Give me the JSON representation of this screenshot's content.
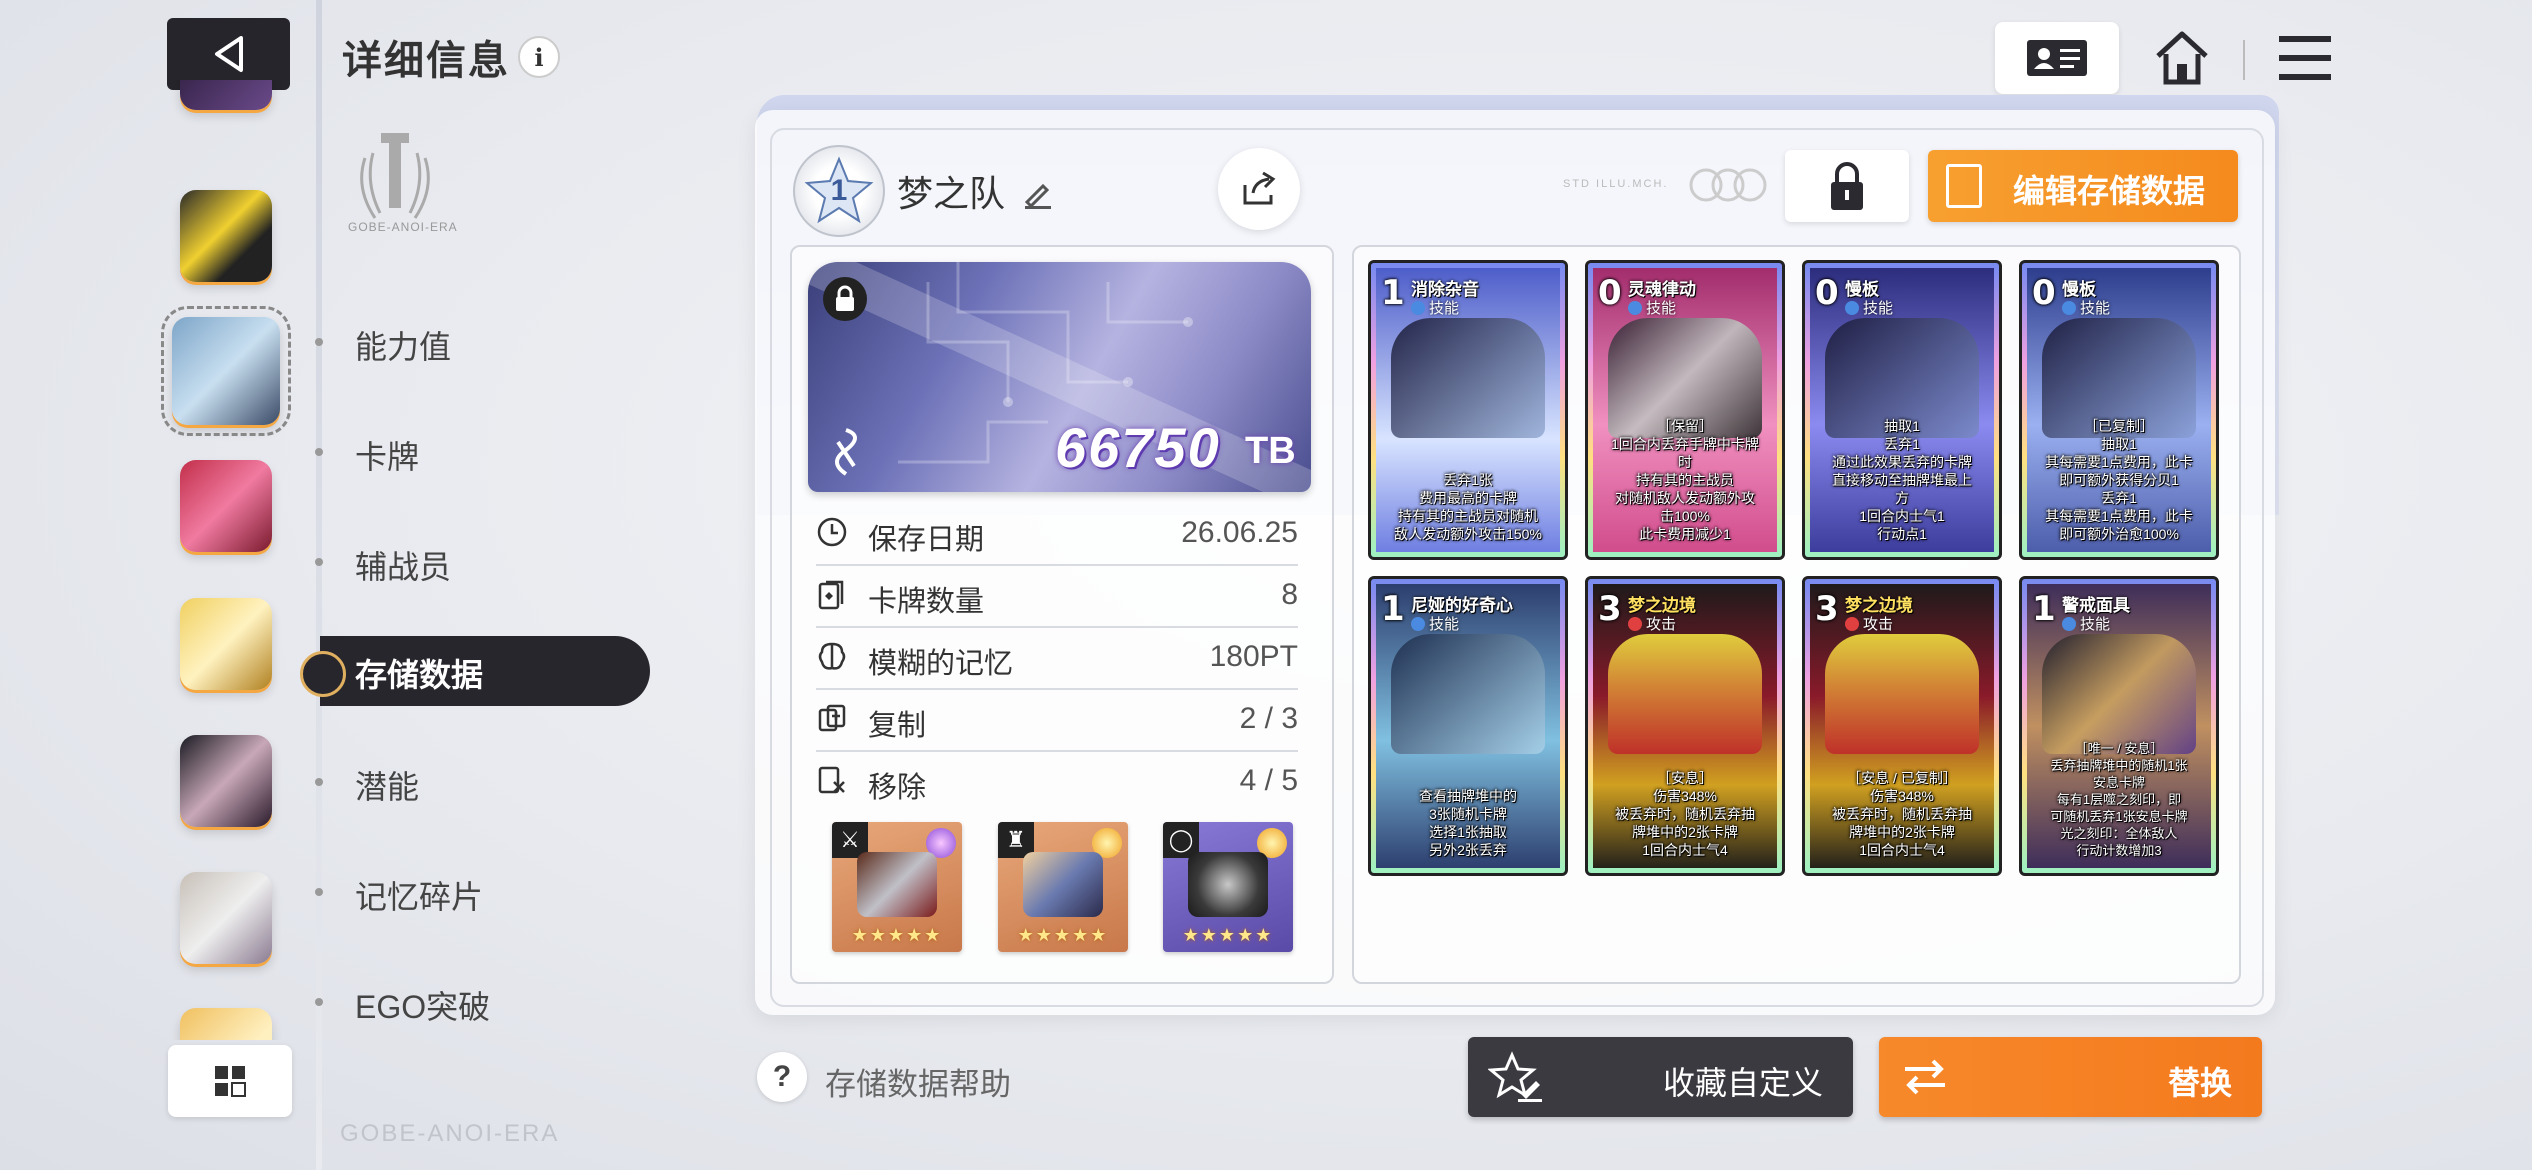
{
  "header": {
    "title": "详细信息",
    "info_icon": "i"
  },
  "nav": {
    "items": [
      "能力值",
      "卡牌",
      "辅战员",
      "存储数据",
      "潜能",
      "记忆碎片",
      "EGO突破"
    ],
    "active_index": 3,
    "active_label": "存储数据"
  },
  "branding": {
    "emblem_text": "GOBE-ANOI-ERA",
    "bottom_logo": "GOBE-ANOI-ERA"
  },
  "deck": {
    "rank": "1",
    "name": "梦之队",
    "lock_tag": "STD ILLU.MCH.",
    "edit_label": "编辑存储数据"
  },
  "tb": {
    "value": "66750",
    "unit": "TB"
  },
  "stats": [
    {
      "label": "保存日期",
      "value": "26.06.25",
      "icon": "clock-icon"
    },
    {
      "label": "卡牌数量",
      "value": "8",
      "icon": "cards-icon"
    },
    {
      "label": "模糊的记忆",
      "value": "180PT",
      "icon": "brain-icon"
    },
    {
      "label": "复制",
      "value": "2 / 3",
      "icon": "copy-icon"
    },
    {
      "label": "移除",
      "value": "4 / 5",
      "icon": "remove-icon"
    }
  ],
  "equipment": [
    {
      "name": "sword-equipment",
      "tag": "⚔",
      "stars": "★★★★★"
    },
    {
      "name": "armor-equipment",
      "tag": "♜",
      "stars": "★★★★★"
    },
    {
      "name": "ring-equipment",
      "tag": "◯",
      "stars": "★★★★★"
    }
  ],
  "cards": [
    {
      "cost": "1",
      "name": "消除杂音",
      "type": "技能",
      "desc": "丢弃1张\n费用最高的卡牌\n持有其的主战员对随机\n敌人发动额外攻击150%",
      "colors": [
        "#5a6ad0",
        "#d0e0ff"
      ]
    },
    {
      "cost": "0",
      "name": "灵魂律动",
      "type": "技能",
      "desc": "［保留］\n1回合内丢弃手牌中卡牌\n时\n持有其的主战员\n对随机敌人发动额外攻\n击100%\n此卡费用减少1",
      "colors": [
        "#c02a6a",
        "#f090c0"
      ]
    },
    {
      "cost": "0",
      "name": "慢板",
      "type": "技能",
      "desc": "抽取1\n丢弃1\n通过此效果丢弃的卡牌\n直接移动至抽牌堆最上\n方\n1回合内士气1\n行动点1",
      "colors": [
        "#3a3a8a",
        "#a0a0ff"
      ]
    },
    {
      "cost": "0",
      "name": "慢板",
      "type": "技能",
      "desc": "［已复制］\n抽取1\n其每需要1点费用，此卡\n即可额外获得分贝1\n丢弃1\n其每需要1点费用，此卡\n即可额外治愈100%",
      "colors": [
        "#3a4a8a",
        "#a0b0ff"
      ]
    },
    {
      "cost": "1",
      "name": "尼娅的好奇心",
      "type": "技能",
      "desc": "查看抽牌堆中的\n3张随机卡牌\n选择1张抽取\n另外2张丢弃",
      "colors": [
        "#2a3a6a",
        "#80c0e0"
      ]
    },
    {
      "cost": "3",
      "name": "梦之边境",
      "type": "攻击",
      "desc": "［安息］\n伤害348%\n被丢弃时，随机丢弃抽\n牌堆中的2张卡牌\n1回合内士气4",
      "colors": [
        "#8a1a2a",
        "#f0e040"
      ]
    },
    {
      "cost": "3",
      "name": "梦之边境",
      "type": "攻击",
      "desc": "［安息 / 已复制］\n伤害348%\n被丢弃时，随机丢弃抽\n牌堆中的2张卡牌\n1回合内士气4",
      "colors": [
        "#8a1a2a",
        "#f0e040"
      ]
    },
    {
      "cost": "1",
      "name": "警戒面具",
      "type": "技能",
      "desc": "［唯一 / 安息］\n丢弃抽牌堆中的随机1张\n安息卡牌\n每有1层噬之刻印，即\n可随机丢弃1张安息卡牌\n光之刻印：全体敌人\n行动计数增加3",
      "colors": [
        "#3a2a5a",
        "#c09060"
      ]
    }
  ],
  "bottom": {
    "help_label": "存储数据帮助",
    "help_icon": "?",
    "favorite_label": "收藏自定义",
    "swap_label": "替换"
  }
}
